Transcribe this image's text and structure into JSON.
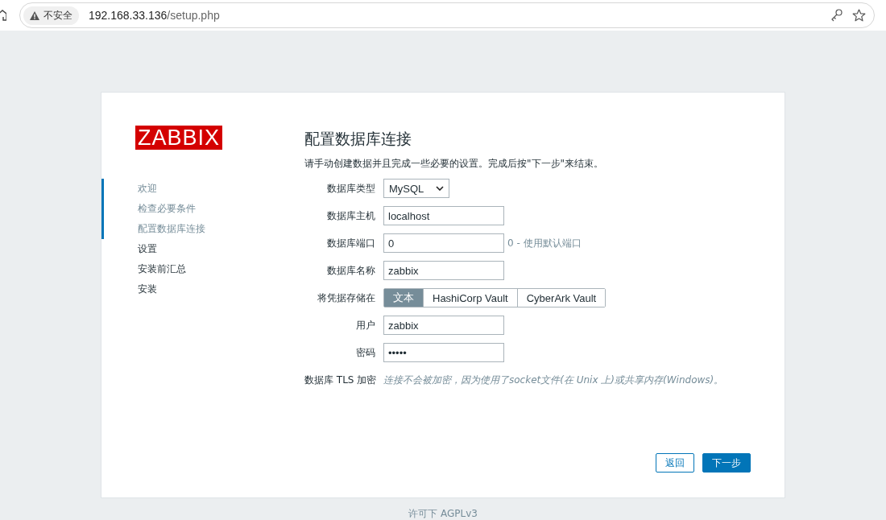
{
  "browser": {
    "security": "不安全",
    "url_host": "192.168.33.136",
    "url_path": "/setup.php"
  },
  "logo": "ZABBIX",
  "steps": [
    {
      "label": "欢迎",
      "completed": true
    },
    {
      "label": "检查必要条件",
      "completed": true
    },
    {
      "label": "配置数据库连接",
      "completed": true
    },
    {
      "label": "设置",
      "completed": false
    },
    {
      "label": "安装前汇总",
      "completed": false
    },
    {
      "label": "安装",
      "completed": false
    }
  ],
  "title": "配置数据库连接",
  "intro": "请手动创建数据并且完成一些必要的设置。完成后按\"下一步\"来结束。",
  "fields": [
    {
      "kind": "select",
      "label": "数据库类型",
      "value": "MySQL"
    },
    {
      "kind": "input",
      "label": "数据库主机",
      "value": "localhost"
    },
    {
      "kind": "input",
      "label": "数据库端口",
      "value": "0",
      "hint": "0 - 使用默认端口"
    },
    {
      "kind": "input",
      "label": "数据库名称",
      "value": "zabbix"
    },
    {
      "kind": "segmented",
      "label": "将凭据存储在",
      "options": [
        {
          "label": "文本",
          "selected": true
        },
        {
          "label": "HashiCorp Vault",
          "selected": false
        },
        {
          "label": "CyberArk Vault",
          "selected": false
        }
      ]
    },
    {
      "kind": "input",
      "label": "用户",
      "value": "zabbix"
    },
    {
      "kind": "input",
      "label": "密码",
      "value": "•••••"
    },
    {
      "kind": "note",
      "label": "数据库 TLS 加密",
      "value": "连接不会被加密，因为使用了socket文件(在 Unix 上)或共享内存(Windows)。"
    }
  ],
  "buttons": {
    "back": "返回",
    "next": "下一步"
  },
  "footer": "许可下 AGPLv3"
}
